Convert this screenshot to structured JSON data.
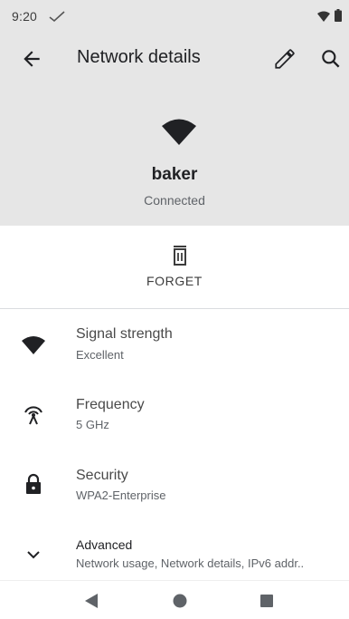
{
  "status_bar": {
    "time": "9:20",
    "icons": [
      "check-icon",
      "wifi-icon",
      "battery-icon"
    ]
  },
  "app_bar": {
    "title": "Network details",
    "back_icon": "arrow-back-icon",
    "edit_icon": "pencil-icon",
    "search_icon": "search-icon"
  },
  "network": {
    "name": "baker",
    "status": "Connected",
    "icon": "wifi-icon"
  },
  "forget": {
    "label": "FORGET",
    "icon": "trash-icon"
  },
  "details": [
    {
      "icon": "wifi-signal-icon",
      "title": "Signal strength",
      "subtitle": "Excellent"
    },
    {
      "icon": "antenna-icon",
      "title": "Frequency",
      "subtitle": "5 GHz"
    },
    {
      "icon": "lock-icon",
      "title": "Security",
      "subtitle": "WPA2-Enterprise"
    },
    {
      "icon": "chevron-down-icon",
      "title": "Advanced",
      "subtitle": "Network usage, Network details, IPv6 addr.."
    }
  ],
  "nav_bar": {
    "icons": [
      "nav-back-icon",
      "nav-home-icon",
      "nav-recents-icon"
    ]
  },
  "colors": {
    "header_bg": "#e6e6e6",
    "text_primary": "#202124",
    "text_secondary": "#5f6368",
    "icon": "#202124"
  }
}
